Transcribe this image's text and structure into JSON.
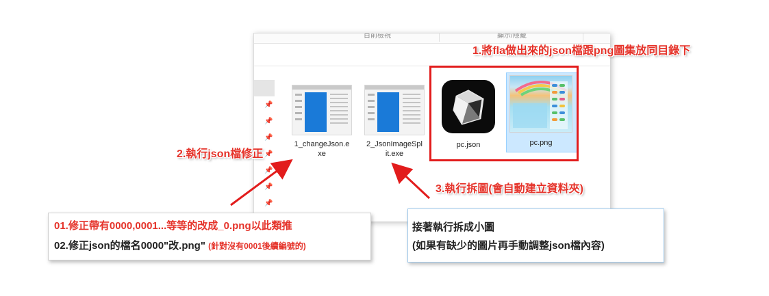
{
  "explorer": {
    "ribbon_groups": [
      "目前檢視",
      "顯示/隱藏"
    ],
    "files": [
      {
        "name": "1_changeJson.exe",
        "label_line1": "1_changeJson.e",
        "label_line2": "xe",
        "icon": "exe-app-icon"
      },
      {
        "name": "2_JsonImageSplit.exe",
        "label_line1": "2_JsonImageSpl",
        "label_line2": "it.exe",
        "icon": "exe-app-icon"
      },
      {
        "name": "pc.json",
        "label_line1": "pc.json",
        "icon": "json-cube-icon"
      },
      {
        "name": "pc.png",
        "label_line1": "pc.png",
        "icon": "png-thumbnail",
        "selected": true
      }
    ],
    "pin_icons": 7
  },
  "annotations": {
    "step1": "1.將fla做出來的json檔跟png圖集放同目錄下",
    "step2": "2.執行json檔修正",
    "step3": "3.執行拆圖(會自動建立資料夾)"
  },
  "notes": {
    "left": {
      "line1": "01.修正帶有0000,0001...等等的改成_0.png以此類推",
      "line2_main": "02.修正json的檔名0000\"改.png\"",
      "line2_small": "(針對沒有0001後續編號的)"
    },
    "right": {
      "line1": "接著執行拆成小圖",
      "line2": "(如果有缺少的圖片再手動調整json檔內容)"
    }
  },
  "colors": {
    "annotation_red": "#e5332a",
    "highlight_red": "#e21c1c",
    "selection_blue": "#cce8ff",
    "exe_blue": "#1a7ad8"
  }
}
